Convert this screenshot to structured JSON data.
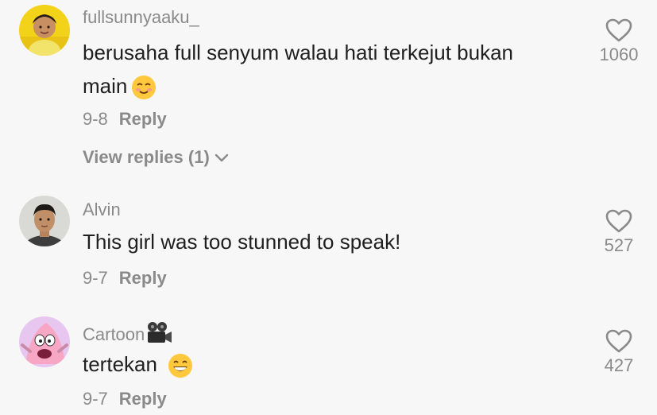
{
  "comments": [
    {
      "username": "fullsunnyaaku_",
      "text_line1": "berusaha full senyum walau hati terkejut bukan",
      "text_line2": "main",
      "emoji": "smiling-face-icon",
      "date": "9-8",
      "reply_label": "Reply",
      "view_replies_label": "View replies (1)",
      "likes": "1060"
    },
    {
      "username": "Alvin",
      "text_line1": "This girl was too stunned to speak!",
      "date": "9-7",
      "reply_label": "Reply",
      "likes": "527"
    },
    {
      "username": "Cartoon",
      "username_emoji": "movie-camera-icon",
      "text_line1": "tertekan",
      "emoji": "grinning-face-icon",
      "date": "9-7",
      "reply_label": "Reply",
      "likes": "427"
    }
  ]
}
